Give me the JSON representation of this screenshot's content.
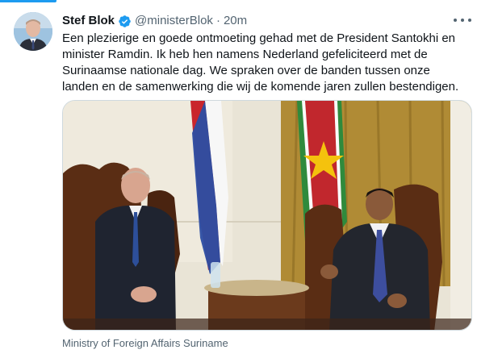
{
  "tweet": {
    "author_name": "Stef Blok",
    "handle": "@ministerBlok",
    "separator": "·",
    "timestamp": "20m",
    "text": "Een plezierige en goede ontmoeting gehad met de President Santokhi en minister Ramdin. Ik heb hen namens Nederland gefeliciteerd met de Surinaamse nationale dag. We spraken over de banden tussen onze landen en de samenwerking die wij de komende jaren zullen bestendigen.",
    "media_caption": "Ministry of Foreign Affairs Suriname"
  },
  "icons": {
    "verified": "verified-badge-icon",
    "more": "more-options-icon"
  },
  "colors": {
    "accent": "#1d9bf0",
    "text": "#0f1419",
    "secondary": "#536471"
  }
}
